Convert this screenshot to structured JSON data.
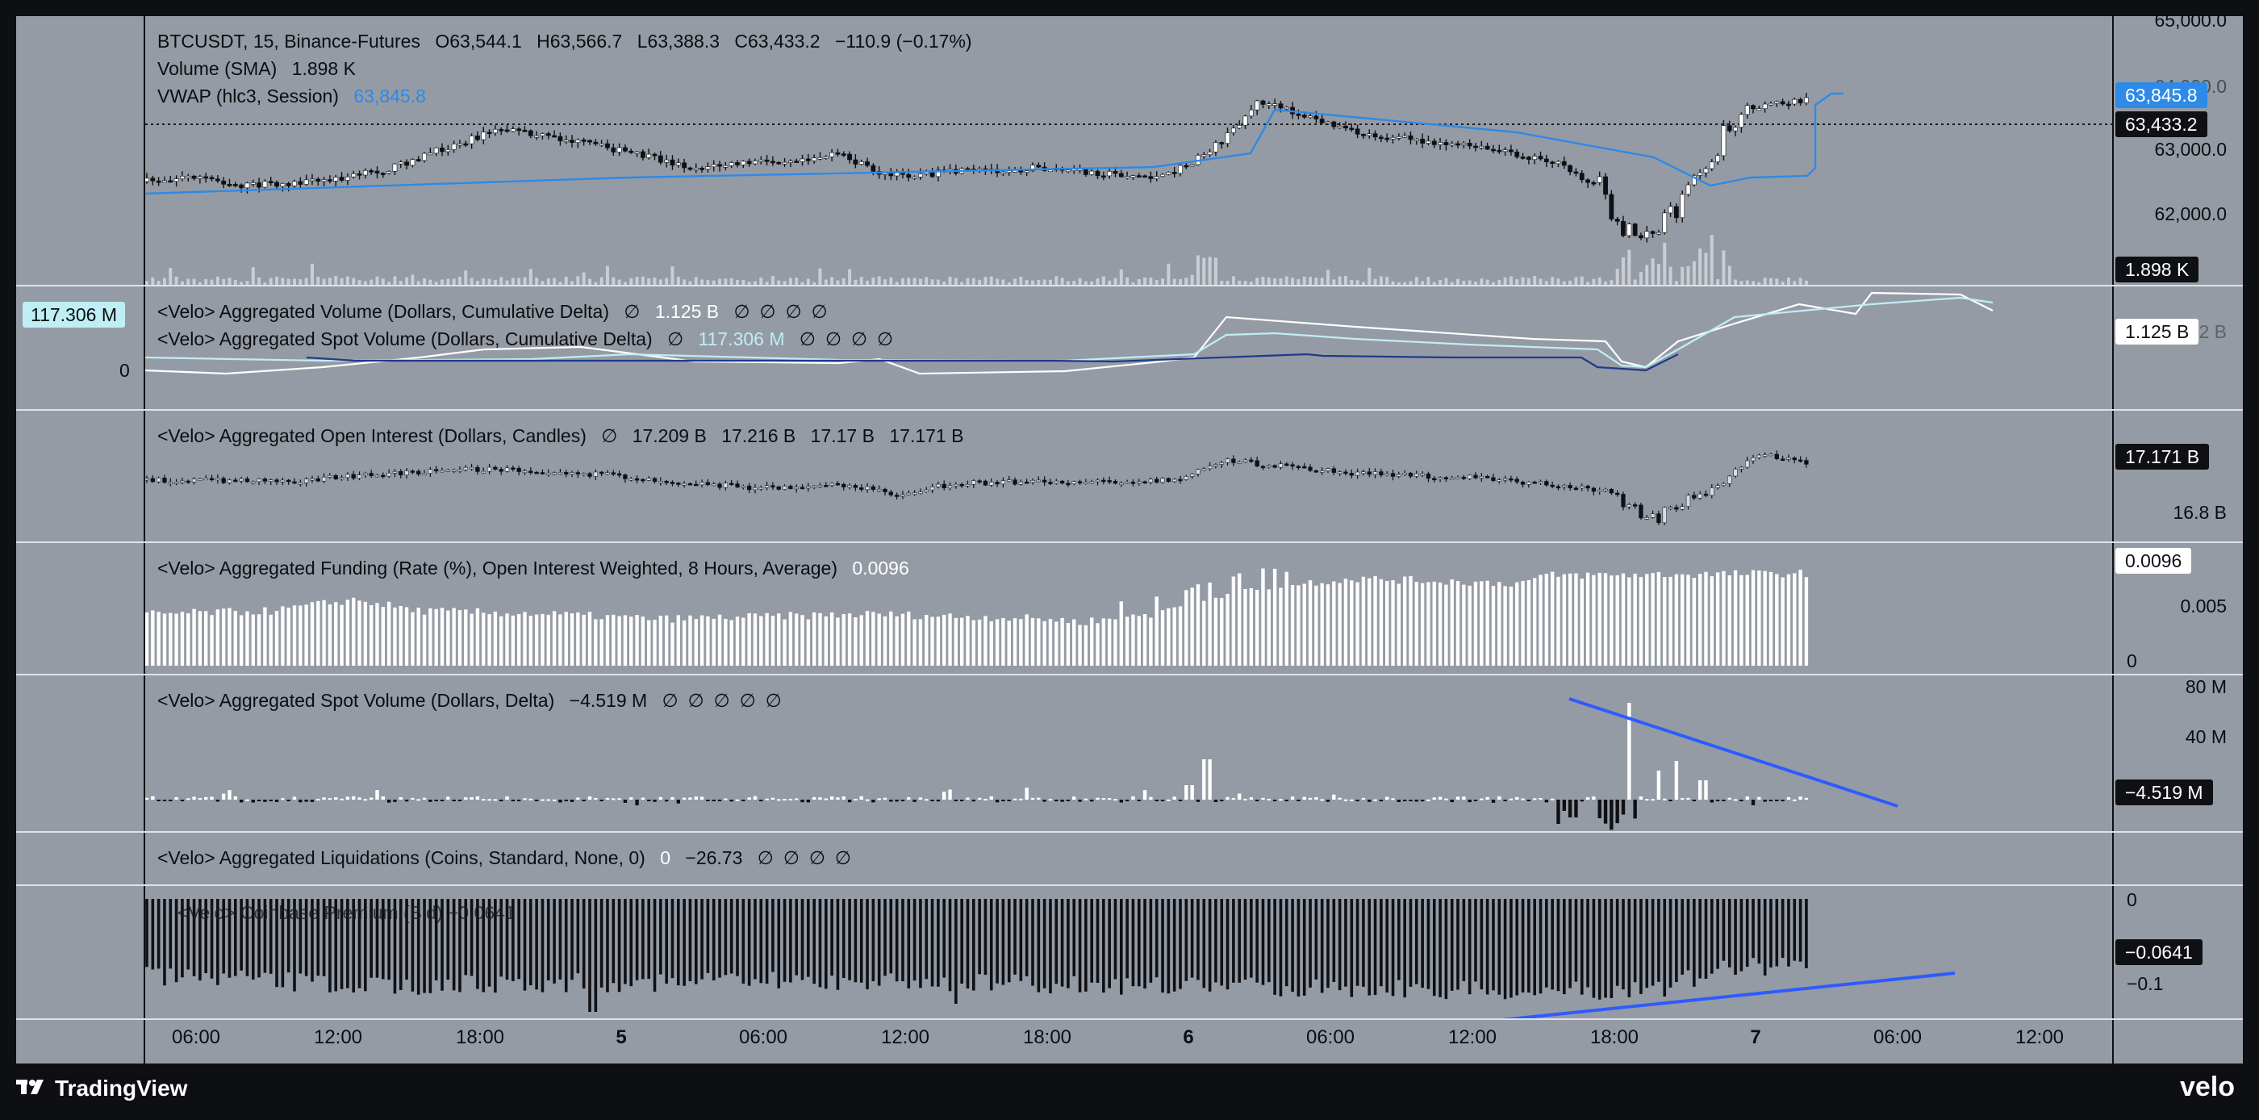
{
  "main": {
    "symbol_line": [
      "BTCUSDT, 15, Binance-Futures",
      "O63,544.1",
      "H63,566.7",
      "L63,388.3",
      "C63,433.2",
      "−110.9 (−0.17%)"
    ],
    "volume_label": "Volume (SMA)",
    "volume_value": "1.898 K",
    "vwap_label": "VWAP (hlc3, Session)",
    "vwap_value": "63,845.8",
    "axis_ticks": [
      "65,000.0",
      "64,000.0",
      "63,000.0",
      "62,000.0"
    ],
    "price_tags": {
      "vwap": "63,845.8",
      "close": "63,433.2",
      "volume": "1.898 K"
    }
  },
  "cum_delta": {
    "line1_label": "<Velo> Aggregated Volume (Dollars, Cumulative Delta)",
    "line1_value": "1.125 B",
    "line2_label": "<Velo> Aggregated Spot Volume (Dollars, Cumulative Delta)",
    "line2_value": "117.306 M",
    "left_tag": "117.306 M",
    "left_zero": "0",
    "right_tag": "1.125 B",
    "axis_tick": "1.2 B"
  },
  "open_interest": {
    "label": "<Velo> Aggregated Open Interest (Dollars, Candles)",
    "values": [
      "17.209 B",
      "17.216 B",
      "17.17 B",
      "17.171 B"
    ],
    "right_tag": "17.171 B",
    "axis_tick": "16.8 B"
  },
  "funding": {
    "label": "<Velo> Aggregated Funding (Rate (%), Open Interest Weighted, 8 Hours, Average)",
    "value": "0.0096",
    "right_tag": "0.0096",
    "axis_ticks": [
      "0.005",
      "0"
    ]
  },
  "spot_delta": {
    "label": "<Velo> Aggregated Spot Volume (Dollars, Delta)",
    "value": "−4.519 M",
    "right_tag": "−4.519 M",
    "axis_ticks": [
      "80 M",
      "40 M"
    ]
  },
  "liquidations": {
    "label": "<Velo> Aggregated Liquidations (Coins, Standard, None, 0)",
    "value_a": "0",
    "value_b": "−26.73",
    "overlay_text": "<Velo> Coinbase Premium (Bid) −0.0641",
    "right_tag": "−0.0641",
    "axis_ticks": [
      "0",
      "−0.1"
    ]
  },
  "null_glyph": "∅",
  "time_axis": [
    "06:00",
    "12:00",
    "18:00",
    "5",
    "06:00",
    "12:00",
    "18:00",
    "6",
    "06:00",
    "12:00",
    "18:00",
    "7",
    "06:00",
    "12:00"
  ],
  "footer": {
    "tradingview": "TradingView",
    "velo": "velo"
  },
  "colors": {
    "background": "#959ba4",
    "vwap": "#2e8ae6",
    "spot_line": "#bfeef4",
    "trendline": "#2e5bff"
  },
  "icons": [
    "tradingview-logo-icon"
  ]
}
